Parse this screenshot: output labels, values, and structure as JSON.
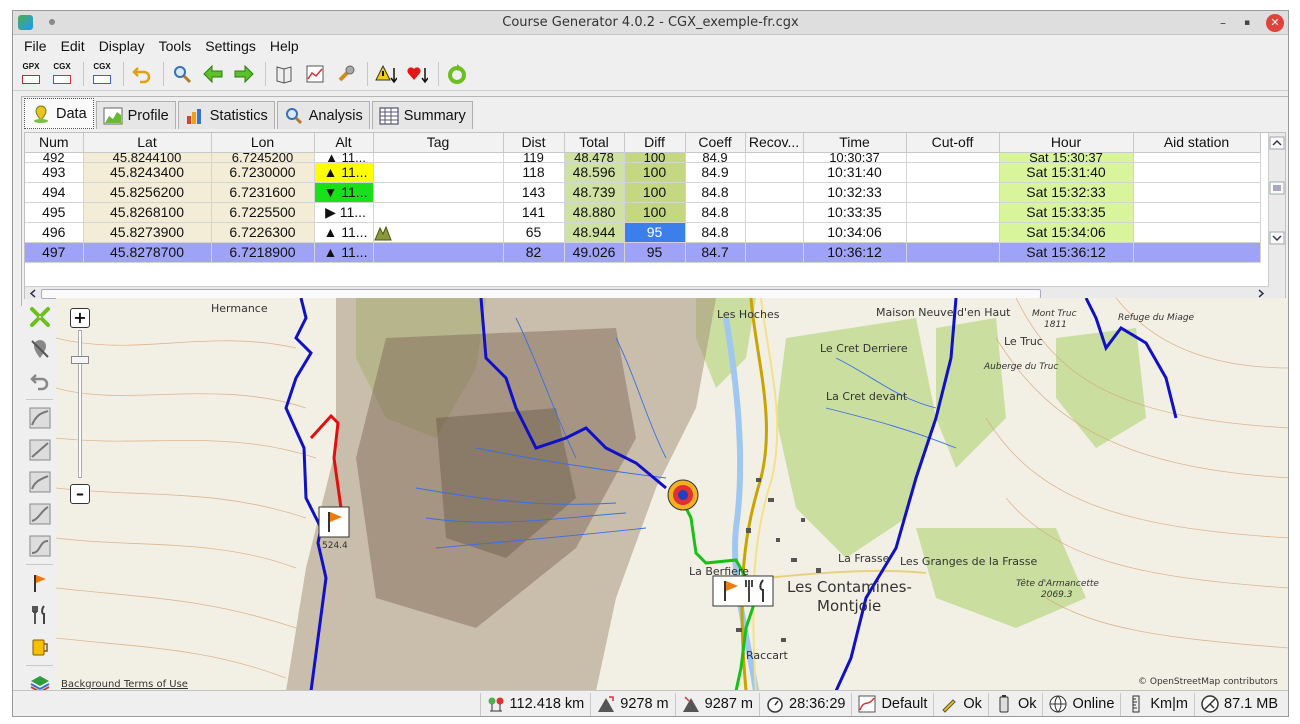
{
  "window": {
    "title": "Course Generator 4.0.2 - CGX_exemple-fr.cgx",
    "minimize": "–",
    "restore": "▪",
    "close": "✕"
  },
  "menu": [
    "File",
    "Edit",
    "Display",
    "Tools",
    "Settings",
    "Help"
  ],
  "toolbar": {
    "open_gpx": "GPX",
    "open_cgx": "CGX",
    "save_cgx": "CGX",
    "icons": [
      "open-gpx-icon",
      "open-cgx-icon",
      "save-cgx-icon",
      "undo-icon",
      "search-icon",
      "previous-icon",
      "next-icon",
      "mrb-icon",
      "graph-icon",
      "settings-wrench-icon",
      "next-warning-icon",
      "next-favorite-icon",
      "refresh-icon"
    ]
  },
  "tabs": [
    "Data",
    "Profile",
    "Statistics",
    "Analysis",
    "Summary"
  ],
  "table": {
    "columns": [
      "Num",
      "Lat",
      "Lon",
      "Alt",
      "Tag",
      "Dist",
      "Total",
      "Diff",
      "Coeff",
      "Recov...",
      "Time",
      "Cut-off",
      "Hour",
      "Aid station"
    ],
    "rows": [
      {
        "num": "492",
        "lat": "45.8244100",
        "lon": "6.7245200",
        "alt": "▲ 11...",
        "tag": "",
        "dist": "119",
        "total": "48.478",
        "diff": "100",
        "coeff": "84.9",
        "recov": "",
        "time": "10:30:37",
        "cutoff": "",
        "hour": "Sat 15:30:37",
        "aid": ""
      },
      {
        "num": "493",
        "lat": "45.8243400",
        "lon": "6.7230000",
        "alt": "▲ 11...",
        "tag": "",
        "dist": "118",
        "total": "48.596",
        "diff": "100",
        "coeff": "84.9",
        "recov": "",
        "time": "10:31:40",
        "cutoff": "",
        "hour": "Sat 15:31:40",
        "aid": ""
      },
      {
        "num": "494",
        "lat": "45.8256200",
        "lon": "6.7231600",
        "alt": "▼ 11...",
        "tag": "",
        "dist": "143",
        "total": "48.739",
        "diff": "100",
        "coeff": "84.8",
        "recov": "",
        "time": "10:32:33",
        "cutoff": "",
        "hour": "Sat 15:32:33",
        "aid": ""
      },
      {
        "num": "495",
        "lat": "45.8268100",
        "lon": "6.7225500",
        "alt": "▶ 11...",
        "tag": "",
        "dist": "141",
        "total": "48.880",
        "diff": "100",
        "coeff": "84.8",
        "recov": "",
        "time": "10:33:35",
        "cutoff": "",
        "hour": "Sat 15:33:35",
        "aid": ""
      },
      {
        "num": "496",
        "lat": "45.8273900",
        "lon": "6.7226300",
        "alt": "▲ 11...",
        "tag": "summit",
        "dist": "65",
        "total": "48.944",
        "diff": "95",
        "coeff": "84.8",
        "recov": "",
        "time": "10:34:06",
        "cutoff": "",
        "hour": "Sat 15:34:06",
        "aid": ""
      },
      {
        "num": "497",
        "lat": "45.8278700",
        "lon": "6.7218900",
        "alt": "▲ 11...",
        "tag": "",
        "dist": "82",
        "total": "49.026",
        "diff": "95",
        "coeff": "84.7",
        "recov": "",
        "time": "10:36:12",
        "cutoff": "",
        "hour": "Sat 15:36:12",
        "aid": ""
      }
    ]
  },
  "map": {
    "zoom_in": "+",
    "zoom_out": "–",
    "labels": {
      "hermance": "Hermance",
      "les_hoches": "Les Hoches",
      "maison_neuve": "Maison Neuve d'en Haut",
      "mont_truc": "Mont Truc",
      "mont_truc_alt": "1811",
      "refuge": "Refuge du Miage",
      "le_cret_derriere": "Le Cret Derriere",
      "le_truc": "Le Truc",
      "auberge": "Auberge du Truc",
      "la_cret_devant": "La Cret devant",
      "la_frasse": "La Frasse",
      "granges": "Les Granges de la Frasse",
      "contamines_1": "Les Contamines-",
      "contamines_2": "Montjoie",
      "la_berfiere": "La Berfiere",
      "raccart": "Raccart",
      "armancette": "Tête d'Armancette",
      "armancette_alt": "2069.3",
      "flag_dist": "524.4"
    },
    "attribution_left": "Background Terms of Use",
    "attribution_right": "© OpenStreetMap contributors",
    "colors": {
      "track": "#1010c8",
      "route_red": "#e01010",
      "route_green": "#18c018",
      "forest": "#b7d79a",
      "rock": "#8c7a66"
    }
  },
  "sidebar_icons": [
    "hide-waypoints-icon",
    "hide-marker-icon",
    "undo-icon",
    "track-curve-1-icon",
    "track-curve-2-icon",
    "track-curve-3-icon",
    "track-curve-4-icon",
    "track-curve-5-icon",
    "flag-icon",
    "restaurant-icon",
    "drink-icon",
    "layers-icon"
  ],
  "status": {
    "distance": "112.418 km",
    "ascent": "9278 m",
    "descent": "9287 m",
    "time": "28:36:29",
    "curve": "Default",
    "edit": "Ok",
    "check": "Ok",
    "network": "Online",
    "units": "Km|m",
    "memory": "87.1 MB"
  }
}
